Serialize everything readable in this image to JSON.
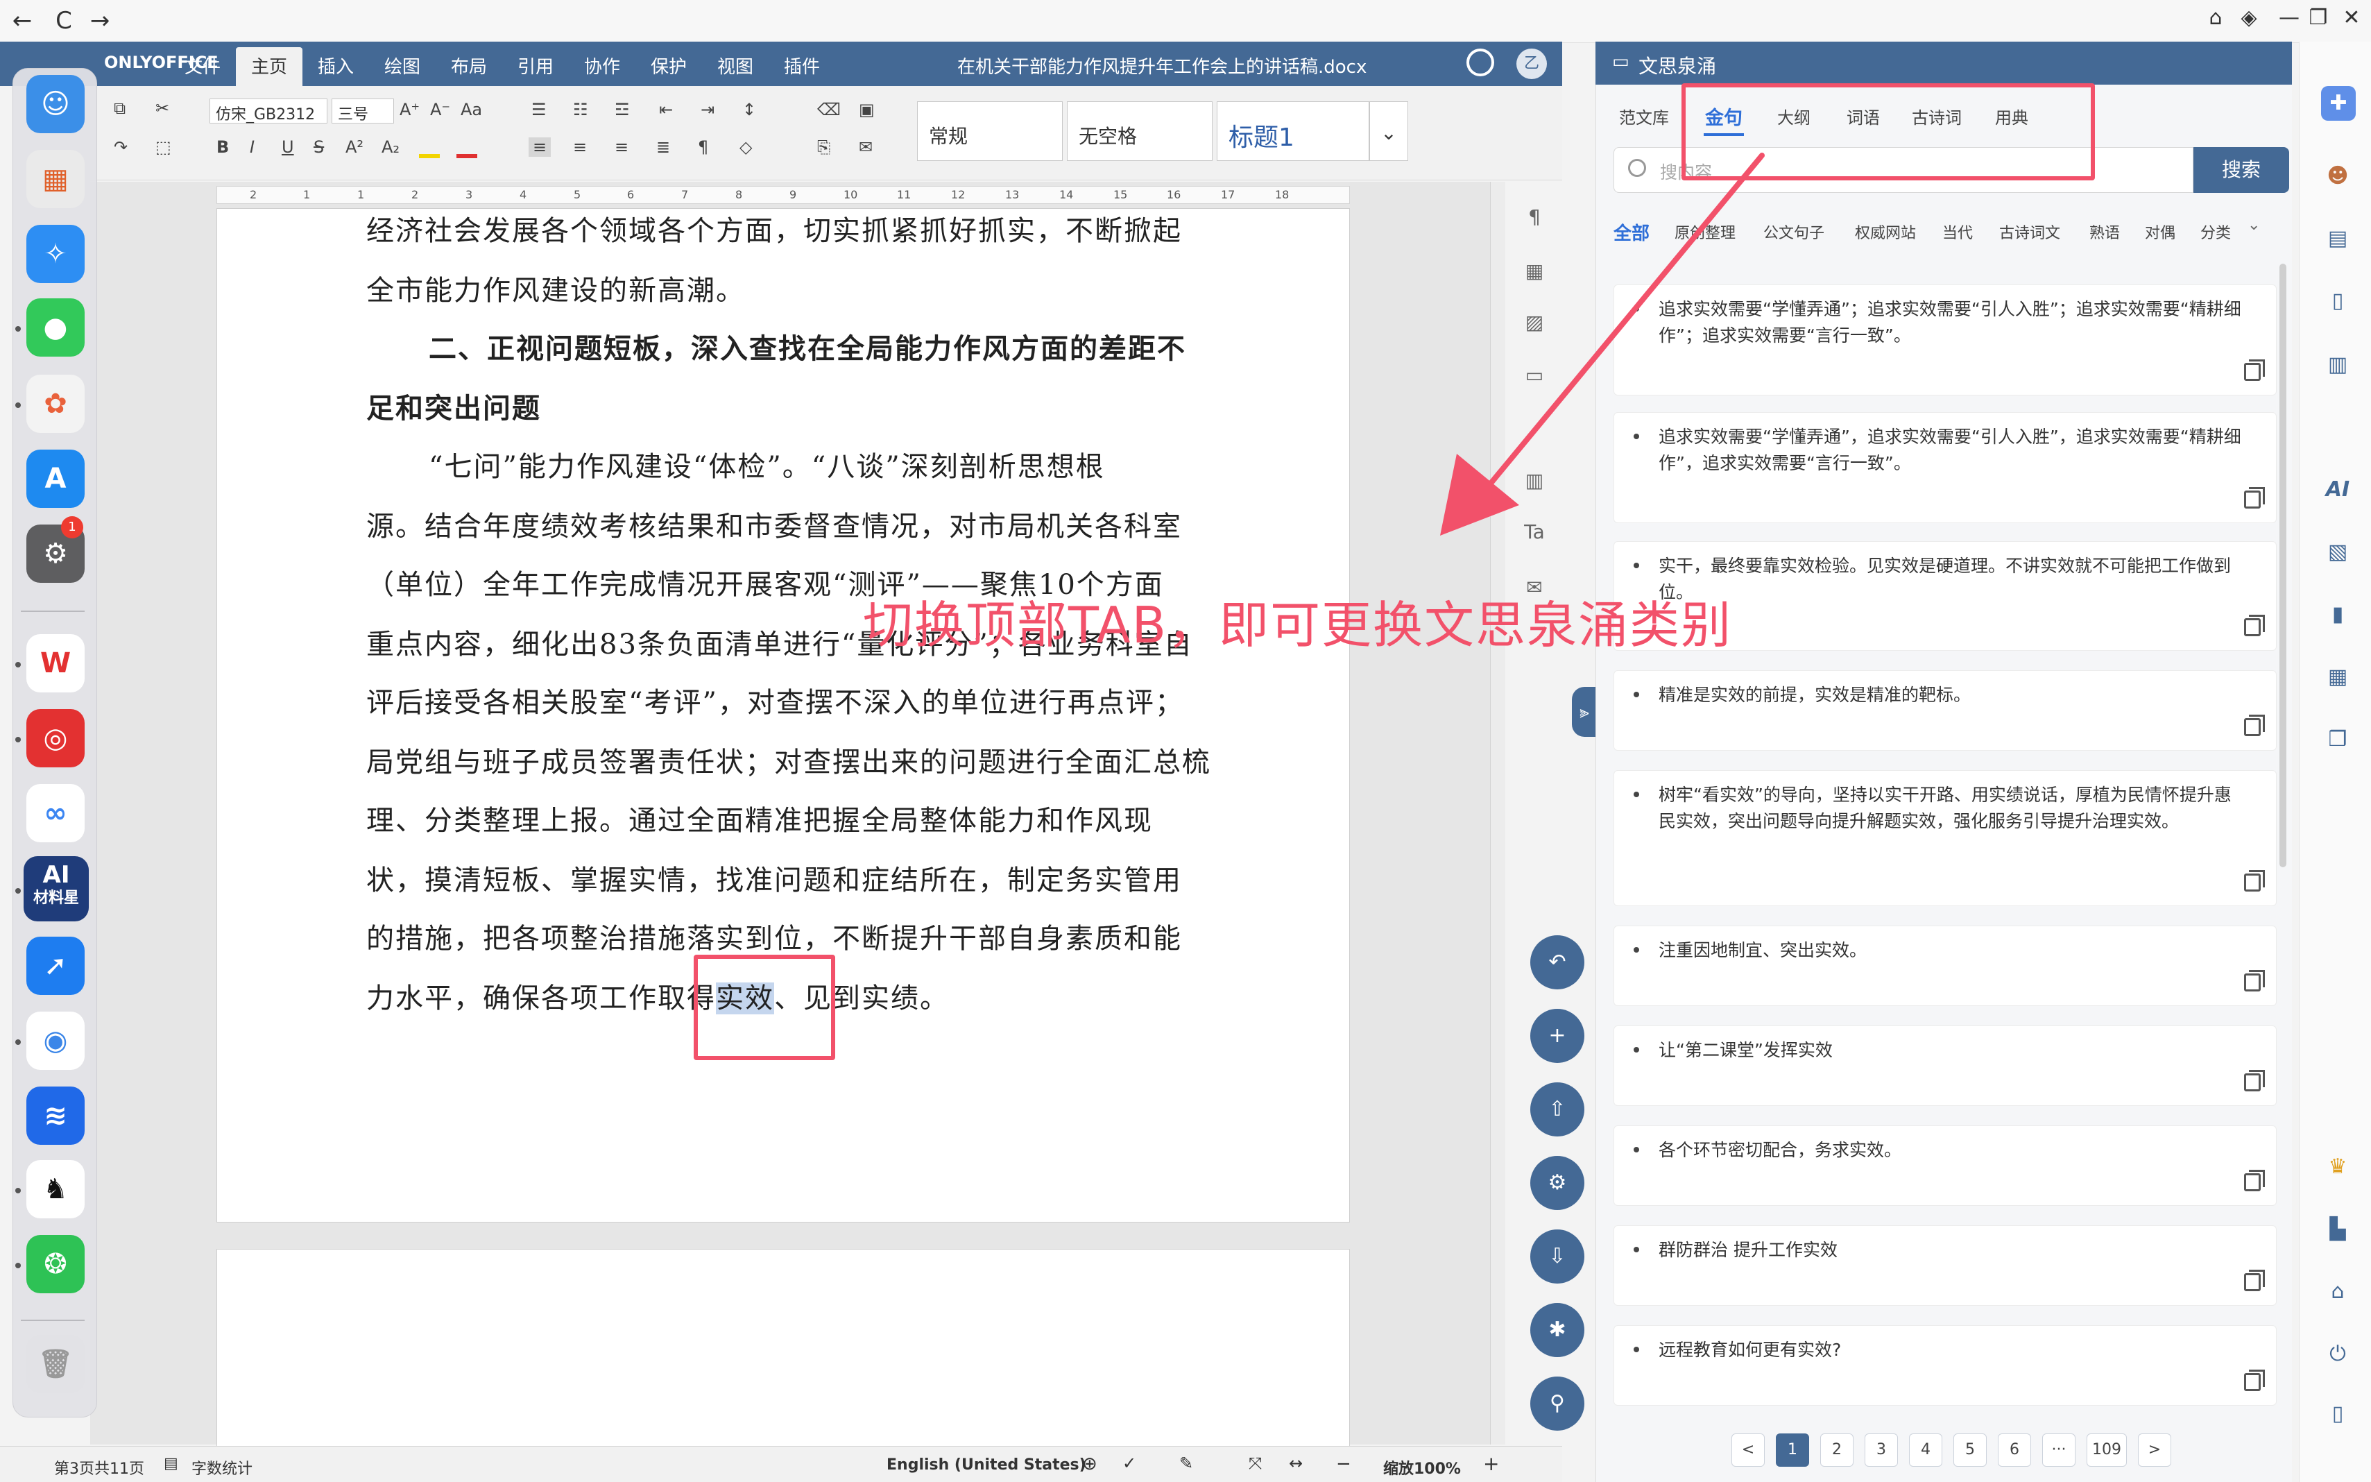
{
  "browser": {
    "back": "←",
    "reload": "C",
    "forward": "→",
    "home": "⌂",
    "shield": "◈",
    "minimize": "—",
    "restore": "❐",
    "close": "✕"
  },
  "app": {
    "logo": "ONLYOFFICE",
    "menu": [
      "文件",
      "主页",
      "插入",
      "绘图",
      "布局",
      "引用",
      "协作",
      "保护",
      "视图",
      "插件"
    ],
    "active_menu": "主页",
    "document_title": "在机关干部能力作风提升年工作会上的讲话稿.docx",
    "user_badge": "乙"
  },
  "toolbar": {
    "font_name": "仿宋_GB2312",
    "font_size": "三号",
    "styles": [
      "常规",
      "无空格",
      "标题1"
    ],
    "buttons": {
      "bold": "B",
      "italic": "I",
      "underline": "U",
      "strike": "S",
      "superscript": "A²",
      "subscript": "A₂"
    }
  },
  "ruler": {
    "ticks": [
      "2",
      "1",
      "1",
      "2",
      "3",
      "4",
      "5",
      "6",
      "7",
      "8",
      "9",
      "10",
      "11",
      "12",
      "13",
      "14",
      "15",
      "16",
      "17",
      "18"
    ]
  },
  "document": {
    "lines": [
      "经济社会发展各个领域各个方面，切实抓紧抓好抓实，不断掀起",
      "全市能力作风建设的新高潮。",
      "二、正视问题短板，深入查找在全局能力作风方面的差距不",
      "足和突出问题",
      "“七问”能力作风建设“体检”。“八谈”深刻剖析思想根",
      "源。结合年度绩效考核结果和市委督查情况，对市局机关各科室",
      "（单位）全年工作完成情况开展客观“测评”——聚焦10个方面",
      "重点内容，细化出83条负面清单进行“量化评分”；各业务科室自",
      "评后接受各相关股室“考评”，对查摆不深入的单位进行再点评；",
      "局党组与班子成员签署责任状；对查摆出来的问题进行全面汇总梳",
      "理、分类整理上报。通过全面精准把握全局整体能力和作风现",
      "状，摸清短板、掌握实情，找准问题和症结所在，制定务实管用",
      "的措施，把各项整治措施落实到位，不断提升干部自身素质和能"
    ],
    "last_line_before": "力水平，确保各项工作取得",
    "last_line_highlight": "实效",
    "last_line_after": "、见到实绩。"
  },
  "annotation": {
    "text": "切换顶部TAB，即可更换文思泉涌类别"
  },
  "statusbar": {
    "page_info": "第3页共11页",
    "word_count": "字数统计",
    "language": "English (United States)",
    "zoom": "缩放100%"
  },
  "dock": {
    "ai_label_top": "AI",
    "ai_label_bottom": "材料星",
    "badge_count": "1"
  },
  "panel": {
    "title": "文思泉涌",
    "tabs": [
      "范文库",
      "金句",
      "大纲",
      "词语",
      "古诗词",
      "用典"
    ],
    "active_tab": "金句",
    "search_placeholder": "搜内容",
    "search_button": "搜索",
    "categories": [
      "全部",
      "原创整理",
      "公文句子",
      "权威网站",
      "当代",
      "古诗词文",
      "熟语",
      "对偶",
      "分类"
    ],
    "active_category": "全部",
    "items": [
      "追求实效需要“学懂弄通”；追求实效需要“引人入胜”；追求实效需要“精耕细作”；追求实效需要“言行一致”。",
      "追求实效需要“学懂弄通”，追求实效需要“引人入胜”，追求实效需要“精耕细作”，追求实效需要“言行一致”。",
      "实干，最终要靠实效检验。见实效是硬道理。不讲实效就不可能把工作做到位。",
      "精准是实效的前提，实效是精准的靶标。",
      "树牢“看实效”的导向，坚持以实干开路、用实绩说话，厚植为民情怀提升惠民实效，突出问题导向提升解题实效，强化服务引导提升治理实效。",
      "注重因地制宜、突出实效。",
      "让“第二课堂”发挥实效",
      "各个环节密切配合，务求实效。",
      "群防群治 提升工作实效",
      "远程教育如何更有实效?"
    ],
    "pagination": [
      "<",
      "1",
      "2",
      "3",
      "4",
      "5",
      "6",
      "···",
      "109",
      ">"
    ],
    "current_page": "1"
  },
  "colors": {
    "accent": "#446995",
    "annotation": "#f2516a",
    "tab_active": "#2f6fd8"
  }
}
